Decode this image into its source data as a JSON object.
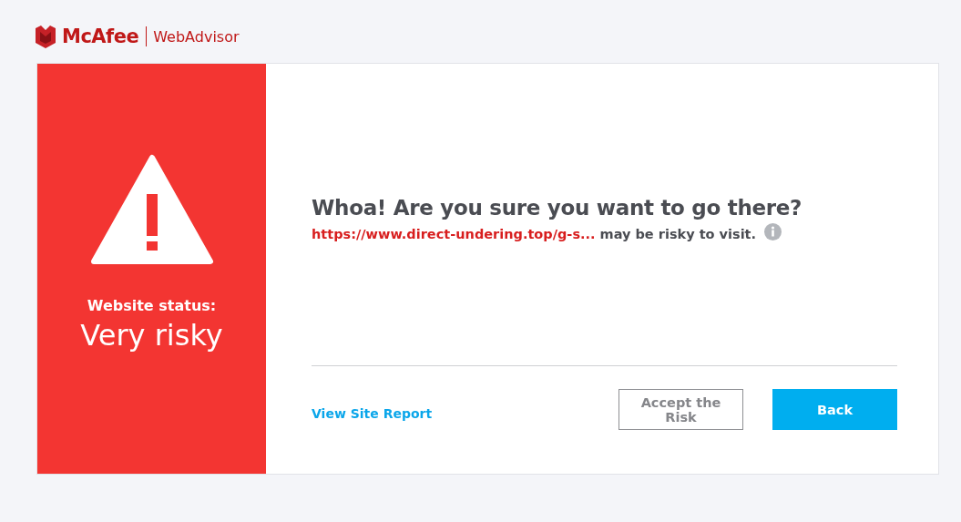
{
  "header": {
    "brand": "McAfee",
    "product": "WebAdvisor"
  },
  "status": {
    "label": "Website status:",
    "value": "Very risky"
  },
  "message": {
    "title": "Whoa! Are you sure you want to go there?",
    "url": "https://www.direct-undering.top/g-s...",
    "text": "may be risky to visit."
  },
  "actions": {
    "link": "View Site Report",
    "buttons": [
      {
        "label": "Accept the Risk",
        "kind": "secondary"
      },
      {
        "label": "Back",
        "kind": "primary"
      }
    ]
  }
}
